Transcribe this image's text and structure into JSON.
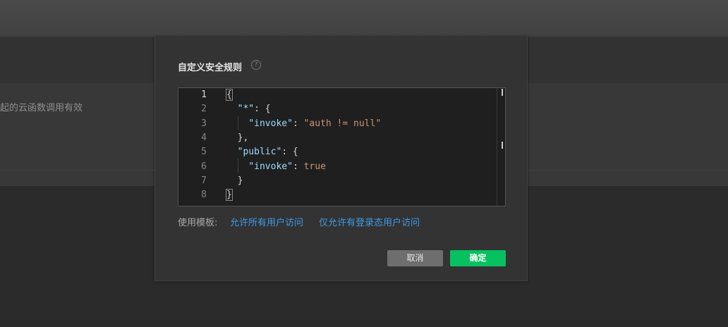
{
  "background": {
    "description_text": "起的云函数调用有效"
  },
  "dialog": {
    "title": "自定义安全规则",
    "help_icon": "?",
    "editor": {
      "line_numbers": [
        "1",
        "2",
        "3",
        "4",
        "5",
        "6",
        "7",
        "8"
      ],
      "active_line": 1,
      "lines": [
        [
          {
            "t": "{",
            "c": "p"
          }
        ],
        [
          {
            "t": "  ",
            "c": "p"
          },
          {
            "t": "\"*\"",
            "c": "k"
          },
          {
            "t": ": {",
            "c": "p"
          }
        ],
        [
          {
            "t": "    ",
            "c": "p"
          },
          {
            "t": "\"invoke\"",
            "c": "k"
          },
          {
            "t": ": ",
            "c": "p"
          },
          {
            "t": "\"auth != null\"",
            "c": "s"
          }
        ],
        [
          {
            "t": "  },",
            "c": "p"
          }
        ],
        [
          {
            "t": "  ",
            "c": "p"
          },
          {
            "t": "\"public\"",
            "c": "k"
          },
          {
            "t": ": {",
            "c": "p"
          }
        ],
        [
          {
            "t": "    ",
            "c": "p"
          },
          {
            "t": "\"invoke\"",
            "c": "k"
          },
          {
            "t": ": ",
            "c": "p"
          },
          {
            "t": "true",
            "c": "b"
          }
        ],
        [
          {
            "t": "  }",
            "c": "p"
          }
        ],
        [
          {
            "t": "}",
            "c": "p"
          }
        ]
      ]
    },
    "templates": {
      "label": "使用模板:",
      "allow_all": "允许所有用户访问",
      "allow_logged_in": "仅允许有登录态用户访问"
    },
    "buttons": {
      "cancel": "取消",
      "confirm": "确定"
    }
  },
  "colors": {
    "confirm_button": "#07c160",
    "link": "#3e9ce8",
    "json_key": "#9cdcfe",
    "json_string": "#ce9178"
  }
}
